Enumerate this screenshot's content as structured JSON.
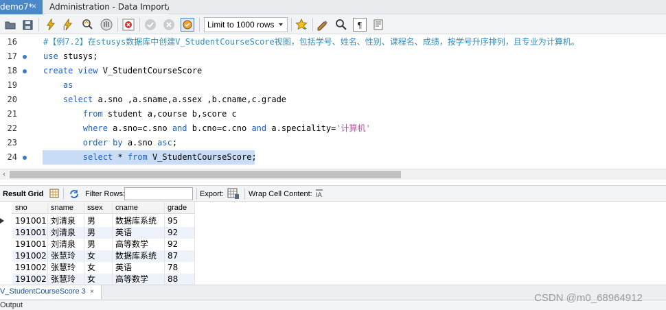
{
  "tabs": {
    "active_label": "demo7*",
    "active_close_glyph": "×",
    "inactive_label": "Administration - Data Import/Res..."
  },
  "toolbar": {
    "limit_select_value": "Limit to 1000 rows",
    "icons": [
      "open-folder-icon",
      "save-icon",
      "execute-icon",
      "execute-current-icon",
      "explain-icon",
      "stop-icon",
      "toggle-error-icon",
      "commit-icon",
      "rollback-icon",
      "autocommit-icon",
      "bookmark-star-icon",
      "beautify-icon",
      "find-icon",
      "invisibles-icon",
      "wrap-icon"
    ]
  },
  "editor": {
    "lines": [
      {
        "num": "16",
        "dot": false,
        "segments": [
          {
            "cls": "cmt",
            "text": "#【例7.2】在stusys数据库中创建V_StudentCourseScore视图，包括学号、姓名、性别、课程名、成绩，按学号升序排列，且专业为计算机。"
          }
        ]
      },
      {
        "num": "17",
        "dot": true,
        "segments": [
          {
            "cls": "kw",
            "text": "use"
          },
          {
            "cls": "plain",
            "text": " stusys;"
          }
        ]
      },
      {
        "num": "18",
        "dot": true,
        "segments": [
          {
            "cls": "kw",
            "text": "create view"
          },
          {
            "cls": "plain",
            "text": " V_StudentCourseScore"
          }
        ]
      },
      {
        "num": "19",
        "dot": false,
        "segments": [
          {
            "cls": "plain",
            "text": "    "
          },
          {
            "cls": "kw",
            "text": "as"
          }
        ]
      },
      {
        "num": "20",
        "dot": false,
        "segments": [
          {
            "cls": "plain",
            "text": "    "
          },
          {
            "cls": "kw",
            "text": "select"
          },
          {
            "cls": "plain",
            "text": " a.sno ,a.sname,a.ssex ,b.cname,c.grade"
          }
        ]
      },
      {
        "num": "21",
        "dot": false,
        "segments": [
          {
            "cls": "plain",
            "text": "        "
          },
          {
            "cls": "kw",
            "text": "from"
          },
          {
            "cls": "plain",
            "text": " student a,course b,score c"
          }
        ]
      },
      {
        "num": "22",
        "dot": false,
        "segments": [
          {
            "cls": "plain",
            "text": "        "
          },
          {
            "cls": "kw",
            "text": "where"
          },
          {
            "cls": "plain",
            "text": " a.sno=c.sno "
          },
          {
            "cls": "kw",
            "text": "and"
          },
          {
            "cls": "plain",
            "text": " b.cno=c.cno "
          },
          {
            "cls": "kw",
            "text": "and"
          },
          {
            "cls": "plain",
            "text": " a.speciality="
          },
          {
            "cls": "str",
            "text": "'计算机'"
          }
        ]
      },
      {
        "num": "23",
        "dot": false,
        "segments": [
          {
            "cls": "plain",
            "text": "        "
          },
          {
            "cls": "kw",
            "text": "order by"
          },
          {
            "cls": "plain",
            "text": " a.sno "
          },
          {
            "cls": "kw",
            "text": "asc"
          },
          {
            "cls": "plain",
            "text": ";"
          }
        ]
      },
      {
        "num": "24",
        "dot": true,
        "selected": true,
        "segments": [
          {
            "cls": "plain",
            "text": "        "
          },
          {
            "cls": "kw",
            "text": "select"
          },
          {
            "cls": "plain",
            "text": " * "
          },
          {
            "cls": "kw",
            "text": "from"
          },
          {
            "cls": "plain",
            "text": " V_StudentCourseScore;"
          }
        ]
      }
    ]
  },
  "result_toolbar": {
    "result_grid_label": "Result Grid",
    "filter_rows_label": "Filter Rows:",
    "filter_value": "",
    "export_label": "Export:",
    "wrap_label": "Wrap Cell Content:"
  },
  "grid": {
    "columns": [
      "sno",
      "sname",
      "ssex",
      "cname",
      "grade"
    ],
    "rows": [
      [
        "191001",
        "刘清泉",
        "男",
        "数据库系统",
        "95"
      ],
      [
        "191001",
        "刘清泉",
        "男",
        "英语",
        "92"
      ],
      [
        "191001",
        "刘清泉",
        "男",
        "高等数学",
        "92"
      ],
      [
        "191002",
        "张慧玲",
        "女",
        "数据库系统",
        "87"
      ],
      [
        "191002",
        "张慧玲",
        "女",
        "英语",
        "78"
      ],
      [
        "191002",
        "张慧玲",
        "女",
        "高等数学",
        "88"
      ]
    ]
  },
  "bottom_tab": {
    "label": "V_StudentCourseScore 3",
    "close_glyph": "×"
  },
  "output_label": "Output",
  "watermark": "CSDN @m0_68964912",
  "colors": {
    "accent": "#4a88c7",
    "keyword": "#1c5ec9",
    "comment": "#2f8dbd",
    "string": "#c04ea5",
    "selection": "#c9def6"
  }
}
